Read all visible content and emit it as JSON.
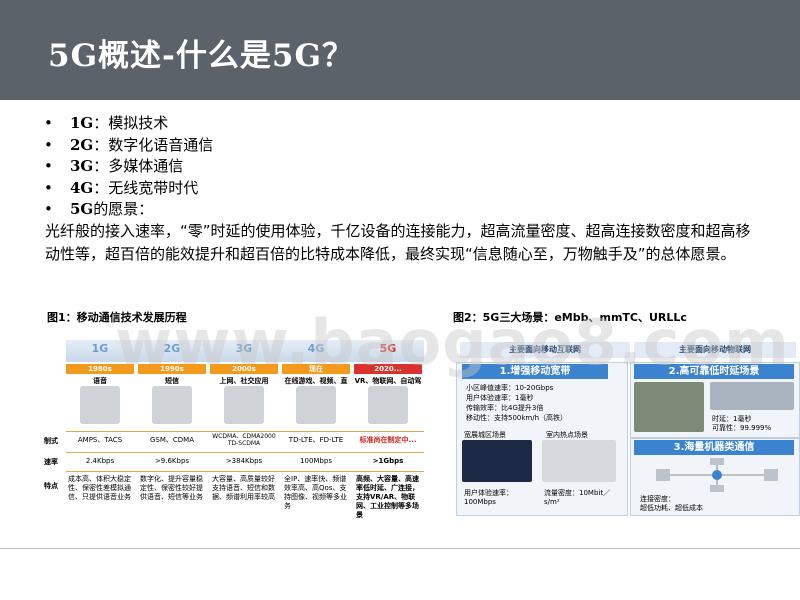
{
  "title": "5G概述-什么是5G？",
  "bullets": [
    {
      "gen": "1G",
      "text": "：模拟技术"
    },
    {
      "gen": "2G",
      "text": "：数字化语音通信"
    },
    {
      "gen": "3G",
      "text": "：多媒体通信"
    },
    {
      "gen": "4G",
      "text": "：无线宽带时代"
    },
    {
      "gen": "5G",
      "text": "的愿景："
    }
  ],
  "vision": "光纤般的接入速率，“零”时延的使用体验，千亿设备的连接能力，超高流量密度、超高连接数密度和超高移动性等，超百倍的能效提升和超百倍的比特成本降低，最终实现“信息随心至，万物触手及”的总体愿景。",
  "figure1": {
    "caption": "图1：移动通信技术发展历程",
    "row_labels": [
      "制式",
      "速率",
      "特点"
    ],
    "columns": [
      {
        "gen": "1G",
        "era": "1980s",
        "service": "语音",
        "standard": "AMPS、TACS",
        "rate": "2.4Kbps",
        "features": "成本高、体积大稳定性、保密性差模拟通信、只提供语音业务"
      },
      {
        "gen": "2G",
        "era": "1990s",
        "service": "短信",
        "standard": "GSM、CDMA",
        "rate": ">9.6Kbps",
        "features": "数字化、提升容量稳定性、保密性较好提供语音、短信等业务"
      },
      {
        "gen": "3G",
        "era": "2000s",
        "service": "上网、社交应用",
        "standard": "WCDMA、CDMA2000 TD-SCDMA",
        "rate": ">384Kbps",
        "features": "大容量、高质量较好支持语音、短信和数据、频谱利用率较高"
      },
      {
        "gen": "4G",
        "era": "现在",
        "service": "在线游戏、视频、直播",
        "standard": "TD-LTE、FD-LTE",
        "rate": "100Mbps",
        "features": "全IP、速率快、频谱效率高、高Qos、支持图像、视频等多业务"
      },
      {
        "gen": "5G",
        "era": "2020...",
        "service": "VR、物联网、自动驾驶",
        "standard": "标准尚在制定中...",
        "rate": ">1Gbps",
        "features": "高频、大容量、高速率低时延、广连接，支持VR/AR、物联网、工业控制等多场景"
      }
    ]
  },
  "figure2": {
    "caption": "图2：5G三大场景：eMbb、mmTC、URLLc",
    "left_band": "主要面向移动互联网",
    "right_band": "主要面向移动物联网",
    "embb": {
      "title": "1.增强移动宽带",
      "specs": [
        "小区峰值速率：10-20Gbps",
        "用户体验速率：1毫秒",
        "传输效率：比4G提升3倍",
        "移动性：支持500km/h（高铁）"
      ],
      "scene1": "宽展城区场景",
      "scene2": "室内热点场景",
      "foot1": "用户体验速率：100Mbps",
      "foot2": "流量密度：10Mbit／s/m²"
    },
    "urllc": {
      "title": "2.高可靠低时延场景",
      "specs": [
        "时延：1毫秒",
        "可靠性：99.999%"
      ]
    },
    "mmtc": {
      "title": "3.海量机器类通信",
      "specs": [
        "连接密度：",
        "超低功耗、超低成本"
      ]
    }
  },
  "watermark": "www.baogao8.com",
  "colors": {
    "title_bar": "#5b6269",
    "era_orange": "#f39a1c",
    "accent_blue": "#3b82cf"
  }
}
